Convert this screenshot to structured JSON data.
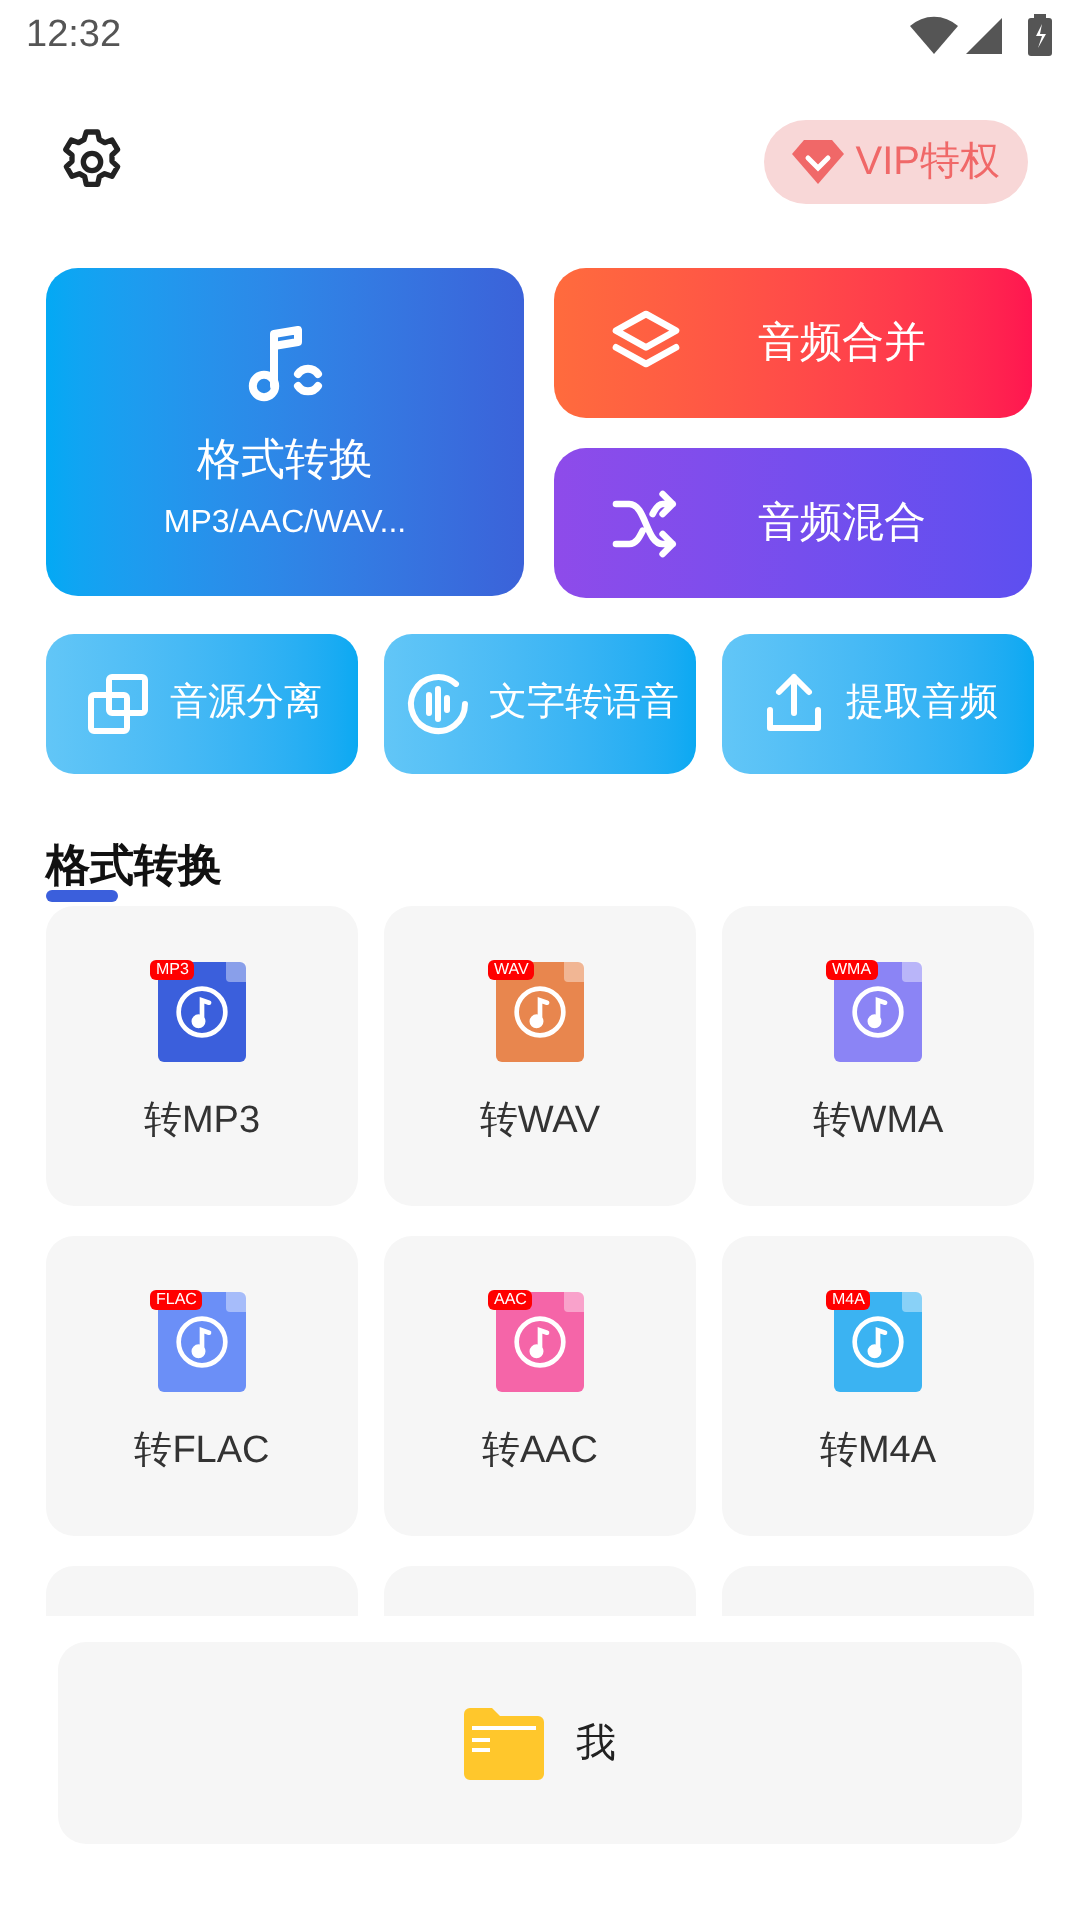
{
  "status_bar": {
    "time": "12:32"
  },
  "header": {
    "vip_label": "VIP特权"
  },
  "main_tools": [
    {
      "kind": "convert",
      "title": "格式转换",
      "subtitle": "MP3/AAC/WAV..."
    },
    {
      "kind": "merge",
      "title": "音频合并"
    },
    {
      "kind": "mix",
      "title": "音频混合"
    }
  ],
  "small_tools": [
    {
      "kind": "separate",
      "title": "音源分离"
    },
    {
      "kind": "tts",
      "title": "文字转语音"
    },
    {
      "kind": "extract",
      "title": "提取音频"
    }
  ],
  "section_title": "格式转换",
  "formats": [
    {
      "tag": "MP3",
      "label": "转MP3",
      "color": "#3b5fdc"
    },
    {
      "tag": "WAV",
      "label": "转WAV",
      "color": "#e8864e"
    },
    {
      "tag": "WMA",
      "label": "转WMA",
      "color": "#8b84f5"
    },
    {
      "tag": "FLAC",
      "label": "转FLAC",
      "color": "#6b8ff7"
    },
    {
      "tag": "AAC",
      "label": "转AAC",
      "color": "#f565a8"
    },
    {
      "tag": "M4A",
      "label": "转M4A",
      "color": "#3bb3f2"
    }
  ],
  "bottom_bar": {
    "label": "我"
  }
}
